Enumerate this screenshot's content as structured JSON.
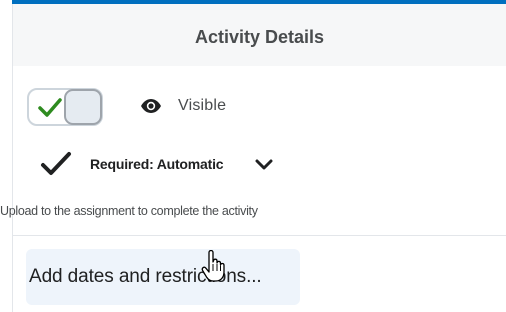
{
  "header": {
    "title": "Activity Details"
  },
  "visibility": {
    "toggle_on": true,
    "toggle_icon": "checkmark-icon",
    "status_icon": "eye-icon",
    "label": "Visible"
  },
  "completion": {
    "status_icon": "checkmark-icon",
    "dropdown_label": "Required: Automatic",
    "dropdown_icon": "chevron-down-icon",
    "description": "Upload to the assignment to complete the activity"
  },
  "dates": {
    "button_label": "Add dates and restrictions..."
  },
  "cursor": {
    "icon": "hand-pointer-icon"
  },
  "colors": {
    "accent": "#006fbf",
    "check_green": "#2e8b1f",
    "button_bg": "#eef4fb",
    "text": "#494c4e"
  }
}
